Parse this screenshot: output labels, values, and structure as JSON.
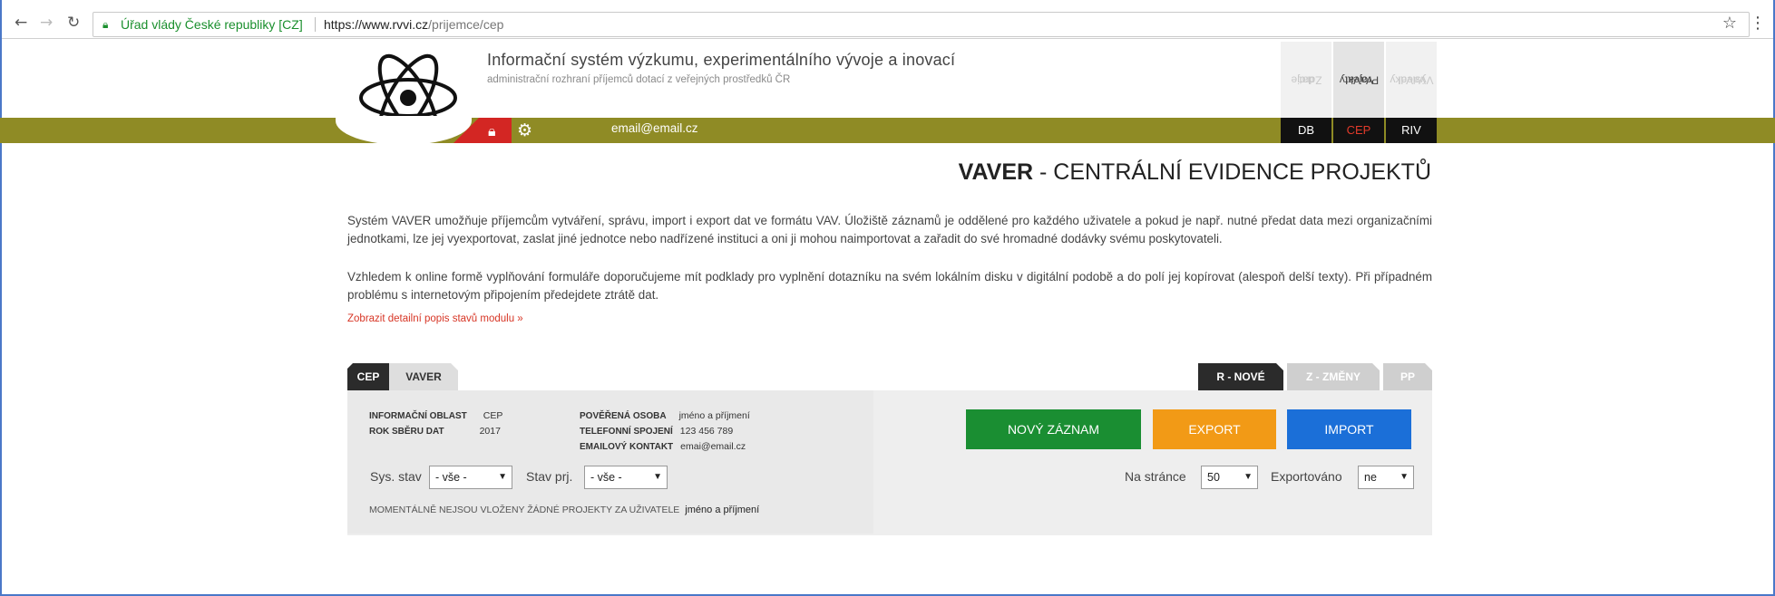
{
  "browser": {
    "secure_label": "Úřad vlády České republiky [CZ]",
    "url_host": "https://www.rvvi.cz",
    "url_path": "/prijemce/cep"
  },
  "header": {
    "title": "Informační systém výzkumu, experimentálního vývoje a inovací",
    "subtitle": "administrační rozhraní příjemců dotací z veřejných prostředků ČR",
    "top_tabs": [
      {
        "label": "Zdroje dat",
        "line1": "Zdroje",
        "line2": "dat",
        "active": false
      },
      {
        "label": "Projekty VaVaI",
        "line1": "Projekty",
        "line2": "VaVaI",
        "active": true
      },
      {
        "label": "Výsledky VaVaI",
        "line1": "Výsledky",
        "line2": "VaVaI",
        "active": false
      }
    ],
    "user_email": "email@email.cz",
    "db_tabs": [
      {
        "label": "DB",
        "active": false
      },
      {
        "label": "CEP",
        "active": true
      },
      {
        "label": "RIV",
        "active": false
      }
    ]
  },
  "main": {
    "title_strong": "VAVER",
    "title_rest": " - CENTRÁLNÍ EVIDENCE PROJEKTŮ",
    "paragraph1": "Systém VAVER umožňuje příjemcům vytváření, správu, import i export dat ve formátu VAV. Úložiště záznamů je oddělené pro každého uživatele a pokud je např. nutné předat data mezi organizačními jednotkami, lze jej vyexportovat, zaslat jiné jednotce nebo nadřízené instituci a oni ji mohou naimportovat a zařadit do své hromadné dodávky svému poskytovateli.",
    "paragraph2": "Vzhledem k online formě vyplňování formuláře doporučujeme mít podklady pro vyplnění dotazníku na svém lokálním disku v digitální podobě a do polí jej kopírovat (alespoň delší texty). Při případném problému s internetovým připojením předejdete ztrátě dat.",
    "detail_link": "Zobrazit detailní popis stavů modulu »"
  },
  "tabs_left": [
    "CEP",
    "VAVER"
  ],
  "tabs_right": [
    "R - NOVÉ",
    "Z - ZMĚNY",
    "PP"
  ],
  "info": {
    "oblast_label": "INFORMAČNÍ OBLAST",
    "oblast_value": "CEP",
    "rok_label": "ROK SBĚRU DAT",
    "rok_value": "2017",
    "osoba_label": "POVĚŘENÁ OSOBA",
    "osoba_value": "jméno a příjmení",
    "telefon_label": "TELEFONNÍ SPOJENÍ",
    "telefon_value": "123 456 789",
    "email_label": "EMAILOVÝ KONTAKT",
    "email_value": "emai@email.cz"
  },
  "buttons": {
    "new": "NOVÝ ZÁZNAM",
    "export": "EXPORT",
    "import": "IMPORT"
  },
  "filters": {
    "sys_stav_label": "Sys. stav",
    "sys_stav_value": "- vše -",
    "stav_prj_label": "Stav prj.",
    "stav_prj_value": "- vše -",
    "na_strance_label": "Na stránce",
    "na_strance_value": "50",
    "exportovano_label": "Exportováno",
    "exportovano_value": "ne"
  },
  "notice": {
    "text": "MOMENTÁLNĚ NEJSOU VLOŽENY ŽÁDNÉ PROJEKTY ZA UŽIVATELE",
    "user": "jméno a příjmení"
  },
  "colors": {
    "olive": "#8f8b25",
    "red": "#d32623",
    "green": "#1a8e32",
    "orange": "#f29a16",
    "blue": "#1b6fd8"
  }
}
